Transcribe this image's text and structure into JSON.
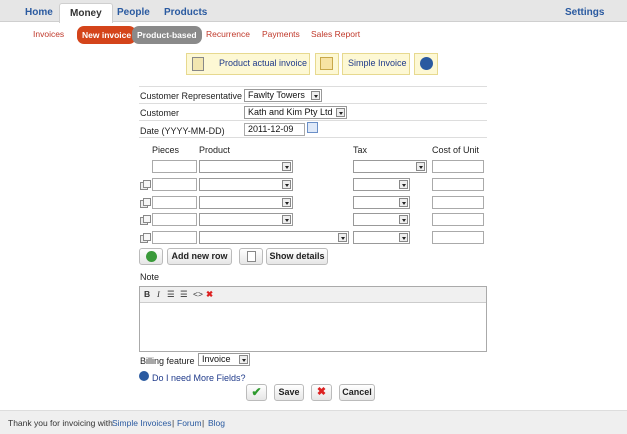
{
  "topnav": {
    "home": "Home",
    "money": "Money",
    "people": "People",
    "products": "Products",
    "settings": "Settings"
  },
  "subnav": {
    "invoices": "Invoices",
    "new_invoice": "New invoice",
    "product_based": "Product-based",
    "recurrence": "Recurrence",
    "payments": "Payments",
    "sales_report": "Sales Report"
  },
  "banner": {
    "product_actual_invoice": "Product actual invoice",
    "simple_invoice": "Simple Invoice"
  },
  "form": {
    "customer_rep_label": "Customer Representative",
    "customer_rep_value": "Fawlty Towers",
    "customer_label": "Customer",
    "customer_value": "Kath and Kim Pty Ltd",
    "date_label": "Date (YYYY-MM-DD)",
    "date_value": "2011-12-09"
  },
  "table": {
    "pieces": "Pieces",
    "product": "Product",
    "tax": "Tax",
    "cost_of_unit": "Cost of Unit"
  },
  "actions": {
    "add_new_row": "Add new row",
    "show_details": "Show details"
  },
  "note": {
    "label": "Note",
    "bold": "B",
    "italic": "I"
  },
  "billing": {
    "label": "Billing feature",
    "value": "Invoice"
  },
  "more_fields": "Do I need More Fields?",
  "buttons": {
    "save": "Save",
    "cancel": "Cancel"
  },
  "footer": {
    "prefix": "Thank you for invoicing with",
    "simple_invoices": "Simple Invoices",
    "sep1": "|",
    "forum": "Forum",
    "sep2": "|",
    "blog": "Blog"
  },
  "colors": {
    "accent_red": "#d4441a",
    "link_blue": "#2a5aa0",
    "banner_bg": "#fdf8d4"
  }
}
